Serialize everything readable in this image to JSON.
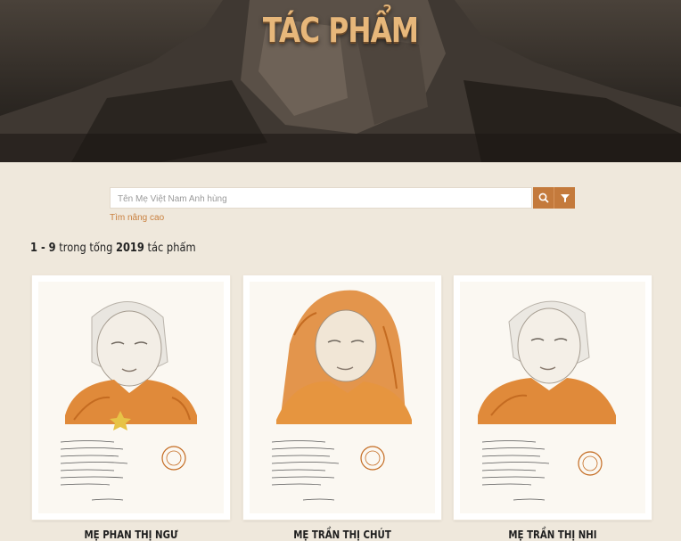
{
  "hero": {
    "title": "TÁC PHẨM"
  },
  "search": {
    "placeholder": "Tên Mẹ Việt Nam Anh hùng",
    "search_icon": "search-icon",
    "filter_icon": "filter-icon",
    "advanced_link": "Tìm nâng cao"
  },
  "results": {
    "range": "1 - 9",
    "between": "trong tổng",
    "total": "2019",
    "suffix": "tác phẩm"
  },
  "cards": [
    {
      "name": "MẸ PHAN THỊ NGƯ"
    },
    {
      "name": "MẸ TRẦN THỊ CHÚT"
    },
    {
      "name": "MẸ TRẦN THỊ NHI"
    }
  ],
  "colors": {
    "accent": "#c47a3c",
    "background": "#efe8dc",
    "portrait": "#e08a3a"
  }
}
